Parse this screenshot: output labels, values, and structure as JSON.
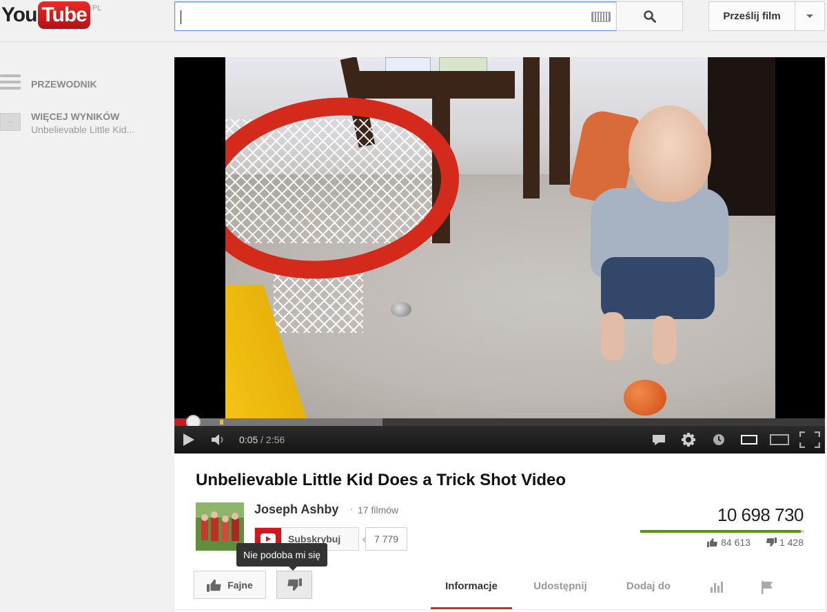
{
  "masthead": {
    "logo_you": "You",
    "logo_tube": "Tube",
    "logo_region": "PL",
    "search_value": "",
    "upload_label": "Prześlij film"
  },
  "guide": {
    "items": [
      {
        "label": "PRZEWODNIK"
      },
      {
        "label": "WIĘCEJ WYNIKÓW",
        "sublabel": "Unbelievable Little Kid..."
      }
    ]
  },
  "player": {
    "current_time": "0:05",
    "separator": " / ",
    "duration": "2:56",
    "played_fraction": 0.0284,
    "buffered_fraction": 0.32
  },
  "video": {
    "title": "Unbelievable Little Kid Does a Trick Shot Video",
    "channel_name": "Joseph Ashby",
    "channel_dot": "·",
    "channel_videos": "17 filmów",
    "subscribe_label": "Subskrybuj",
    "subscriber_count": "7 779",
    "views": "10 698 730",
    "likes": "84 613",
    "dislikes": "1 428",
    "like_ratio": 0.9834,
    "like_label": "Fajne",
    "dislike_tooltip": "Nie podoba mi się"
  },
  "tabs": [
    {
      "label": "Informacje",
      "active": true
    },
    {
      "label": "Udostępnij",
      "active": false
    },
    {
      "label": "Dodaj do",
      "active": false
    }
  ],
  "colors": {
    "brand_red": "#cc181e",
    "like_green": "#559900",
    "active_tab_underline": "#b33b1e"
  },
  "icons": [
    "keyboard-icon",
    "search-icon",
    "chevron-down-icon",
    "guide-menu-icon",
    "more-results-icon",
    "play-icon",
    "volume-icon",
    "captions-icon",
    "settings-icon",
    "watch-later-icon",
    "small-player-icon",
    "large-player-icon",
    "fullscreen-icon",
    "thumbs-up-icon",
    "thumbs-down-icon",
    "stats-icon",
    "flag-icon"
  ]
}
